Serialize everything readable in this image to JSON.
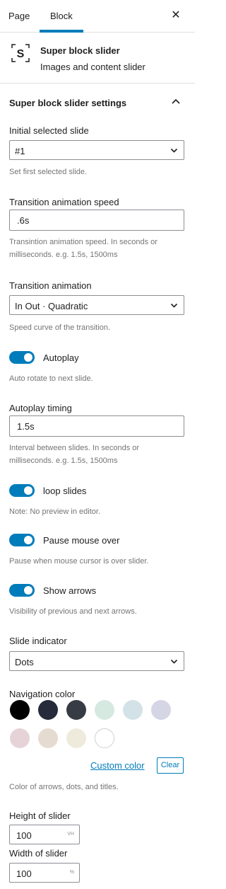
{
  "tabs": {
    "page": "Page",
    "block": "Block"
  },
  "block_card": {
    "title": "Super block slider",
    "description": "Images and content slider"
  },
  "panel": {
    "title": "Super block slider settings"
  },
  "initial_slide": {
    "label": "Initial selected slide",
    "value": "#1",
    "help": "Set first selected slide."
  },
  "speed": {
    "label": "Transition animation speed",
    "value": ".6s",
    "help": "Transintion animation speed. In seconds or milliseconds. e.g. 1.5s, 1500ms"
  },
  "animation": {
    "label": "Transition animation",
    "value": "In Out · Quadratic",
    "help": "Speed curve of the transition."
  },
  "autoplay": {
    "label": "Autoplay",
    "checked": true,
    "help": "Auto rotate to next slide."
  },
  "autoplay_timing": {
    "label": "Autoplay timing",
    "value": "1.5s",
    "help": "Interval between slides. In seconds or milliseconds. e.g. 1.5s, 1500ms"
  },
  "loop": {
    "label": "loop slides",
    "checked": true,
    "help": "Note: No preview in editor."
  },
  "pause": {
    "label": "Pause mouse over",
    "checked": true,
    "help": "Pause when mouse cursor is over slider."
  },
  "arrows": {
    "label": "Show arrows",
    "checked": true,
    "help": "Visibility of previous and next arrows."
  },
  "indicator": {
    "label": "Slide indicator",
    "value": "Dots"
  },
  "nav_color": {
    "label": "Navigation color",
    "swatches": [
      "#000000",
      "#262b3b",
      "#373b44",
      "#d5e9e0",
      "#d3e2e6",
      "#d5d5e6",
      "#e6d3d7",
      "#e6dbd1",
      "#efebdc",
      "#ffffff"
    ],
    "custom_label": "Custom color",
    "clear_label": "Clear",
    "help": "Color of arrows, dots, and titles."
  },
  "height": {
    "label": "Height of slider",
    "value": "100",
    "unit": "VH"
  },
  "width": {
    "label": "Width of slider",
    "value": "100",
    "unit": "%"
  }
}
